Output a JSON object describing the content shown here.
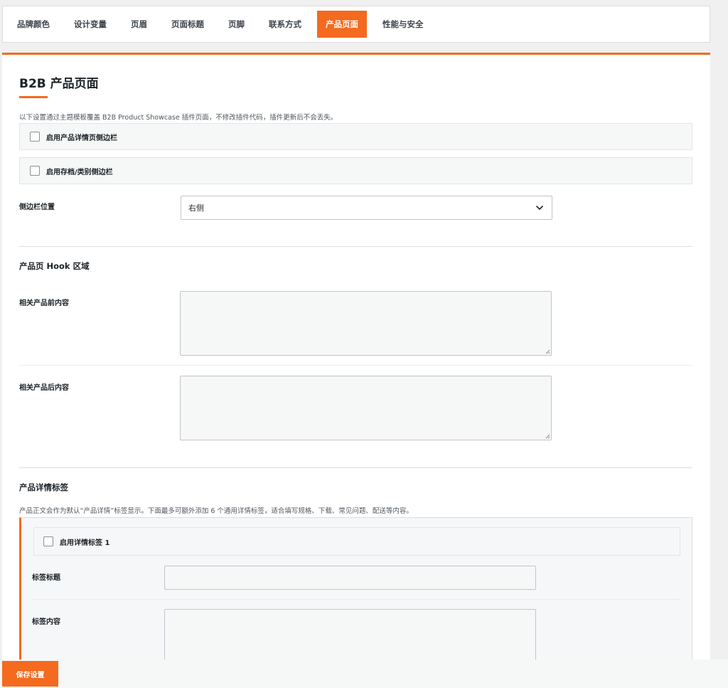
{
  "tabs": [
    {
      "label": "品牌颜色",
      "active": false
    },
    {
      "label": "设计变量",
      "active": false
    },
    {
      "label": "页眉",
      "active": false
    },
    {
      "label": "页面标题",
      "active": false
    },
    {
      "label": "页脚",
      "active": false
    },
    {
      "label": "联系方式",
      "active": false
    },
    {
      "label": "产品页面",
      "active": true
    },
    {
      "label": "性能与安全",
      "active": false
    }
  ],
  "section": {
    "title": "B2B 产品页面",
    "description": "以下设置通过主题模板覆盖 B2B Product Showcase 插件页面，不修改插件代码，插件更新后不会丢失。"
  },
  "checkboxes": {
    "detail_sidebar": {
      "label": "启用产品详情页侧边栏",
      "checked": false
    },
    "archive_sidebar": {
      "label": "启用存档/类别侧边栏",
      "checked": false
    }
  },
  "sidebar_position": {
    "label": "侧边栏位置",
    "value": "右侧",
    "icon": "chevron-down-icon"
  },
  "hooks": {
    "heading": "产品页 Hook 区域",
    "before_related": {
      "label": "相关产品前内容",
      "value": ""
    },
    "after_related": {
      "label": "相关产品后内容",
      "value": ""
    }
  },
  "detail_tabs": {
    "heading": "产品详情标签",
    "description": "产品正文会作为默认“产品详情”标签显示。下面最多可额外添加 6 个通用详情标签，适合填写规格、下载、常见问题、配送等内容。",
    "tab1": {
      "enable_label": "启用详情标签 1",
      "checked": false,
      "title_label": "标签标题",
      "title_value": "",
      "content_label": "标签内容",
      "content_value": ""
    }
  },
  "save_button": "保存设置",
  "colors": {
    "accent": "#f46a1f",
    "border": "#c3c4c7",
    "text": "#1d2327"
  }
}
